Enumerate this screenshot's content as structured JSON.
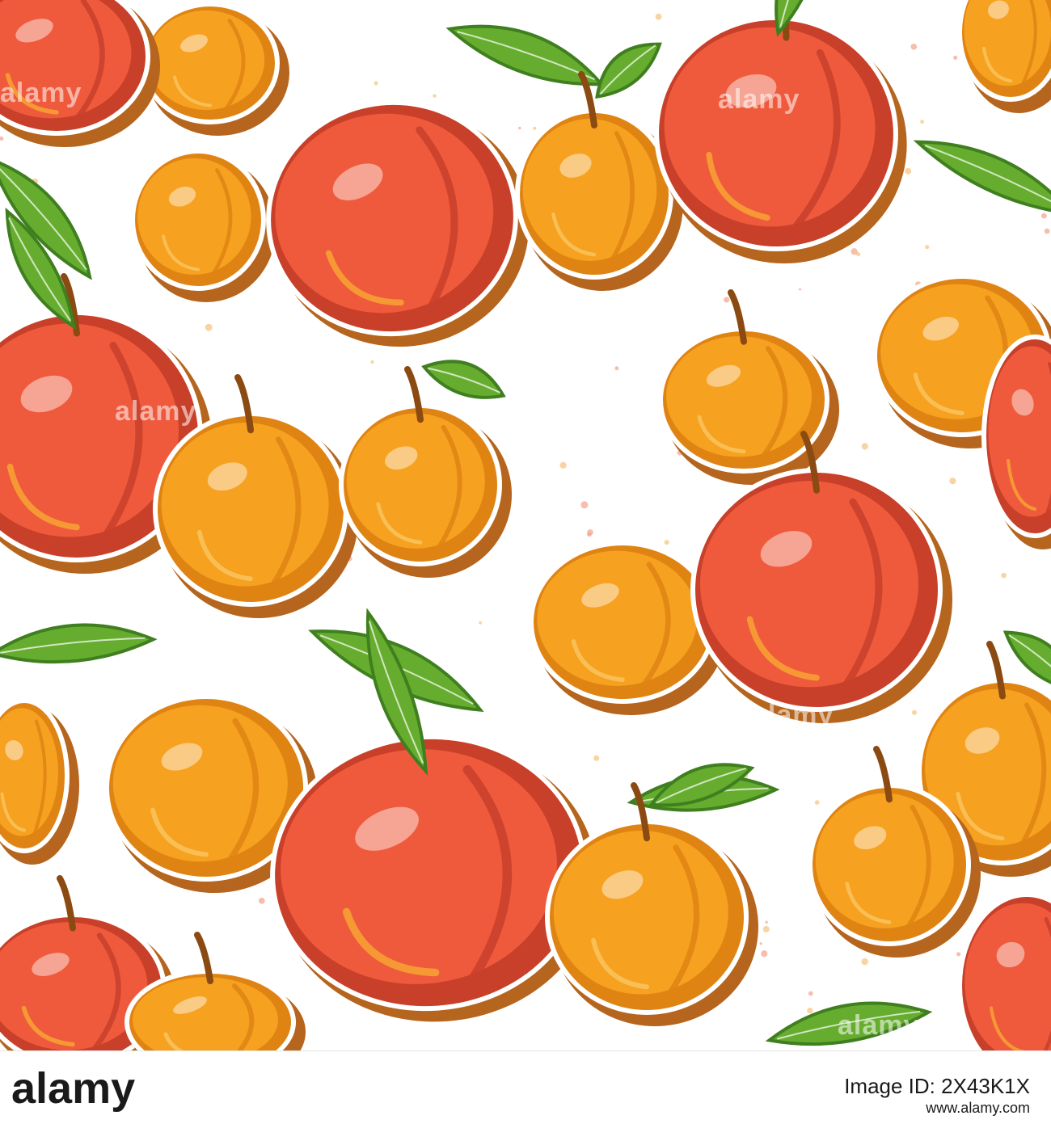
{
  "image": {
    "colors": {
      "background": "#ffffff",
      "peach_red": "#ef5a3c",
      "peach_shade": "#c8402a",
      "apricot_orange": "#f6a11f",
      "apricot_shade": "#df8413",
      "outline_brown": "#b5651d",
      "leaf_green": "#66ad2f",
      "leaf_dark": "#3f7f1f"
    },
    "watermark_text": "alamy",
    "fruit_types": [
      "peach",
      "apricot"
    ]
  },
  "footer": {
    "logo_text": "alamy",
    "image_id": "Image ID: 2X43K1X",
    "url": "www.alamy.com"
  }
}
